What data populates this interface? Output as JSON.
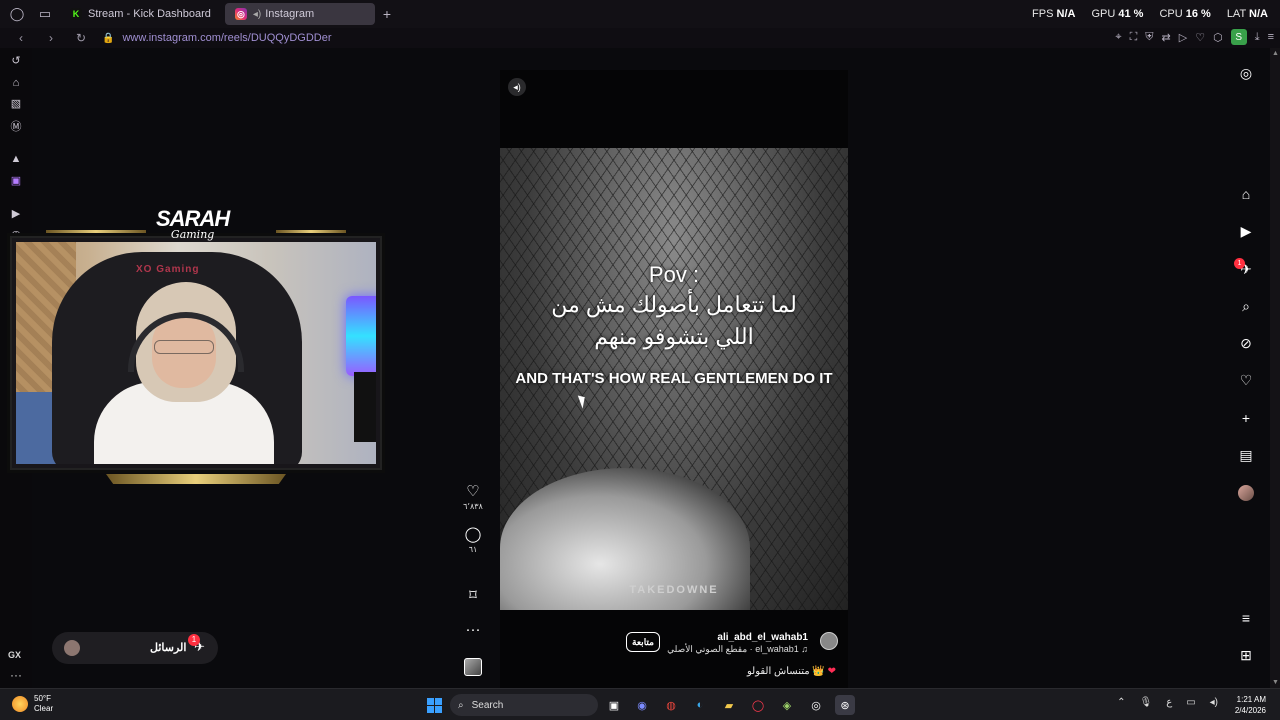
{
  "browser": {
    "tabs": [
      {
        "label": "Stream - Kick Dashboard",
        "favicon": "kick-icon"
      },
      {
        "label": "Instagram",
        "favicon": "instagram-icon"
      }
    ],
    "stats": {
      "fps_label": "FPS",
      "fps_value": "N/A",
      "gpu_label": "GPU",
      "gpu_value": "41 %",
      "cpu_label": "CPU",
      "cpu_value": "16 %",
      "lat_label": "LAT",
      "lat_value": "N/A"
    },
    "url": "www.instagram.com/reels/DUQQyDGDDer",
    "profile_initial": "S"
  },
  "webcam": {
    "logo_main": "SARAH",
    "logo_sub": "Gaming",
    "chair_brand": "XO Gaming"
  },
  "reel": {
    "overlay": {
      "pov": "Pov :",
      "arabic_line_1": "لما تتعامل بأصولك مش من",
      "arabic_line_2": "اللي بتشوفو منهم",
      "english_line": "AND THAT'S HOW REAL GENTLEMEN DO IT"
    },
    "watermark": "TAKEDOWNE",
    "username": "ali_abd_el_wahab1",
    "audio": "♫ el_wahab1 · مقطع الصوتي الأصلي",
    "follow_label": "متابعة",
    "caption": "متنساش القولو 👑",
    "likes": "٦٬٨٣٨",
    "comments": "٦١"
  },
  "messages": {
    "label": "الرسائل",
    "badge": "1"
  },
  "instagram_nav": {
    "notification_badge": "1"
  },
  "taskbar": {
    "weather_temp": "50°F",
    "weather_desc": "Clear",
    "search_label": "Search",
    "time": "1:21 AM",
    "date": "2/4/2026",
    "lang": "ع"
  }
}
